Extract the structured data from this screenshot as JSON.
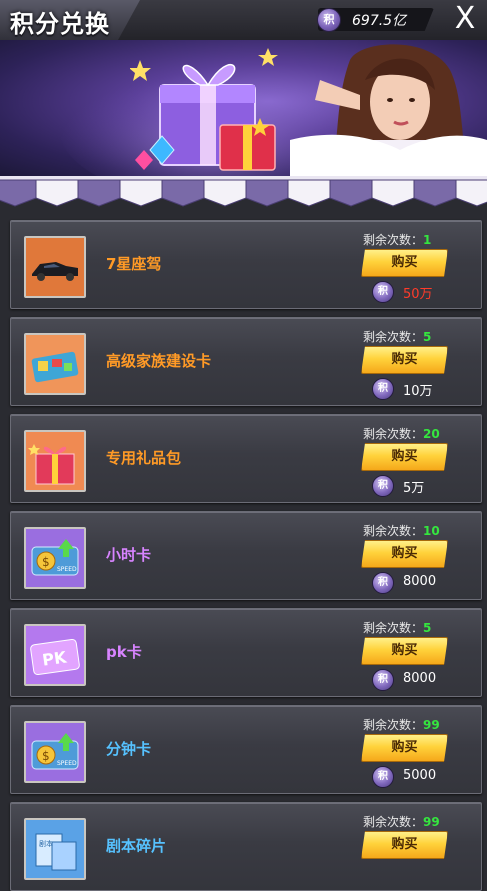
{
  "header": {
    "title": "积分兑换",
    "points_icon_glyph": "积",
    "points_value": "697.5亿",
    "close_glyph": "X"
  },
  "banner": {
    "icons": [
      "gift-box-icon",
      "star-icon",
      "gem-icon",
      "hostess-illustration"
    ]
  },
  "colors": {
    "name_orange": "#ff9a26",
    "name_purple": "#d884ff",
    "name_blue": "#56c2ff",
    "remain_green": "#35e63f",
    "price_red": "#ff3b2a",
    "buy_button_gold": "#ffd23b"
  },
  "labels": {
    "remain_prefix": "剩余次数：",
    "buy": "购买",
    "price_icon_glyph": "积"
  },
  "items": [
    {
      "name": "7星座驾",
      "remain": "1",
      "price": "50万",
      "icon": "car-icon"
    },
    {
      "name": "高级家族建设卡",
      "remain": "5",
      "price": "10万",
      "icon": "construction-card-icon"
    },
    {
      "name": "专用礼品包",
      "remain": "20",
      "price": "5万",
      "icon": "gift-pack-icon"
    },
    {
      "name": "小时卡",
      "remain": "10",
      "price": "8000",
      "icon": "speed-card-icon"
    },
    {
      "name": "pk卡",
      "remain": "5",
      "price": "8000",
      "icon": "pk-card-icon"
    },
    {
      "name": "分钟卡",
      "remain": "99",
      "price": "5000",
      "icon": "speed-card-icon"
    },
    {
      "name": "剧本碎片",
      "remain": "99",
      "price": "",
      "icon": "script-fragment-icon"
    }
  ]
}
